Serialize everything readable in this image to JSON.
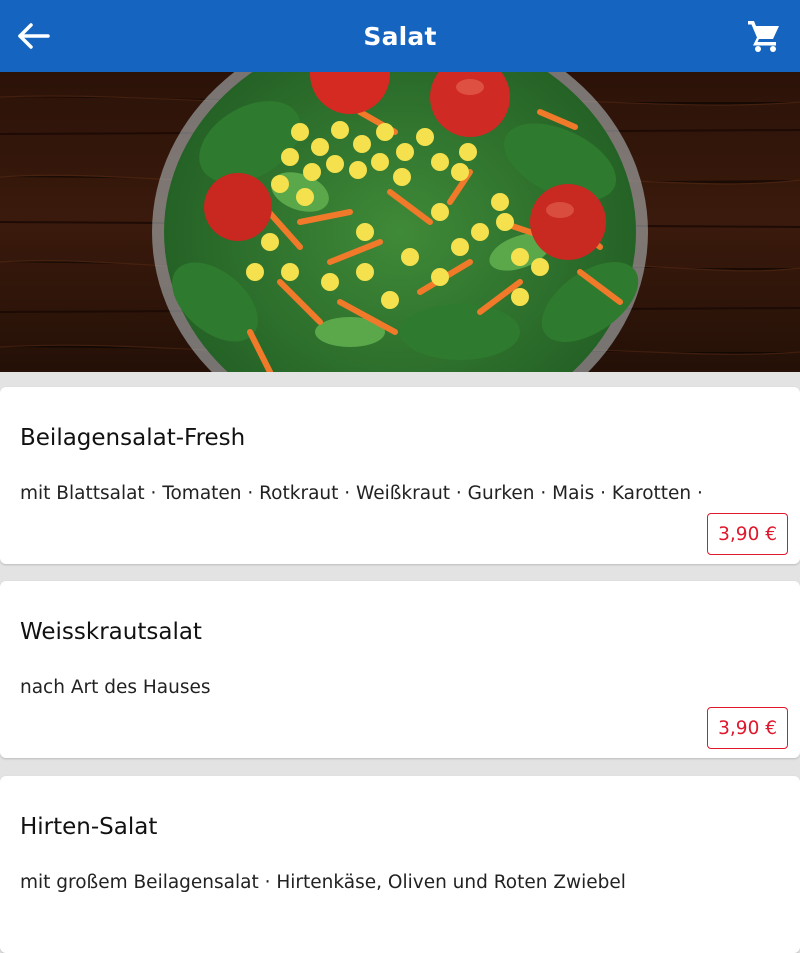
{
  "header": {
    "title": "Salat",
    "back_icon": "arrow-left-icon",
    "cart_icon": "shopping-cart-icon",
    "background": "#1565c0"
  },
  "hero": {
    "image": "salad-bowl-photo"
  },
  "products": [
    {
      "name": "Beilagensalat-Fresh",
      "description": "mit Blattsalat · Tomaten · Rotkraut · Weißkraut · Gurken · Mais · Karotten ·",
      "price": "3,90 €"
    },
    {
      "name": "Weisskrautsalat",
      "description": "nach Art des Hauses",
      "price": "3,90 €"
    },
    {
      "name": "Hirten-Salat",
      "description": "mit großem Beilagensalat · Hirtenkäse, Oliven und Roten Zwiebel",
      "price": ""
    }
  ],
  "colors": {
    "accent": "#1565c0",
    "price": "#e0182d"
  }
}
